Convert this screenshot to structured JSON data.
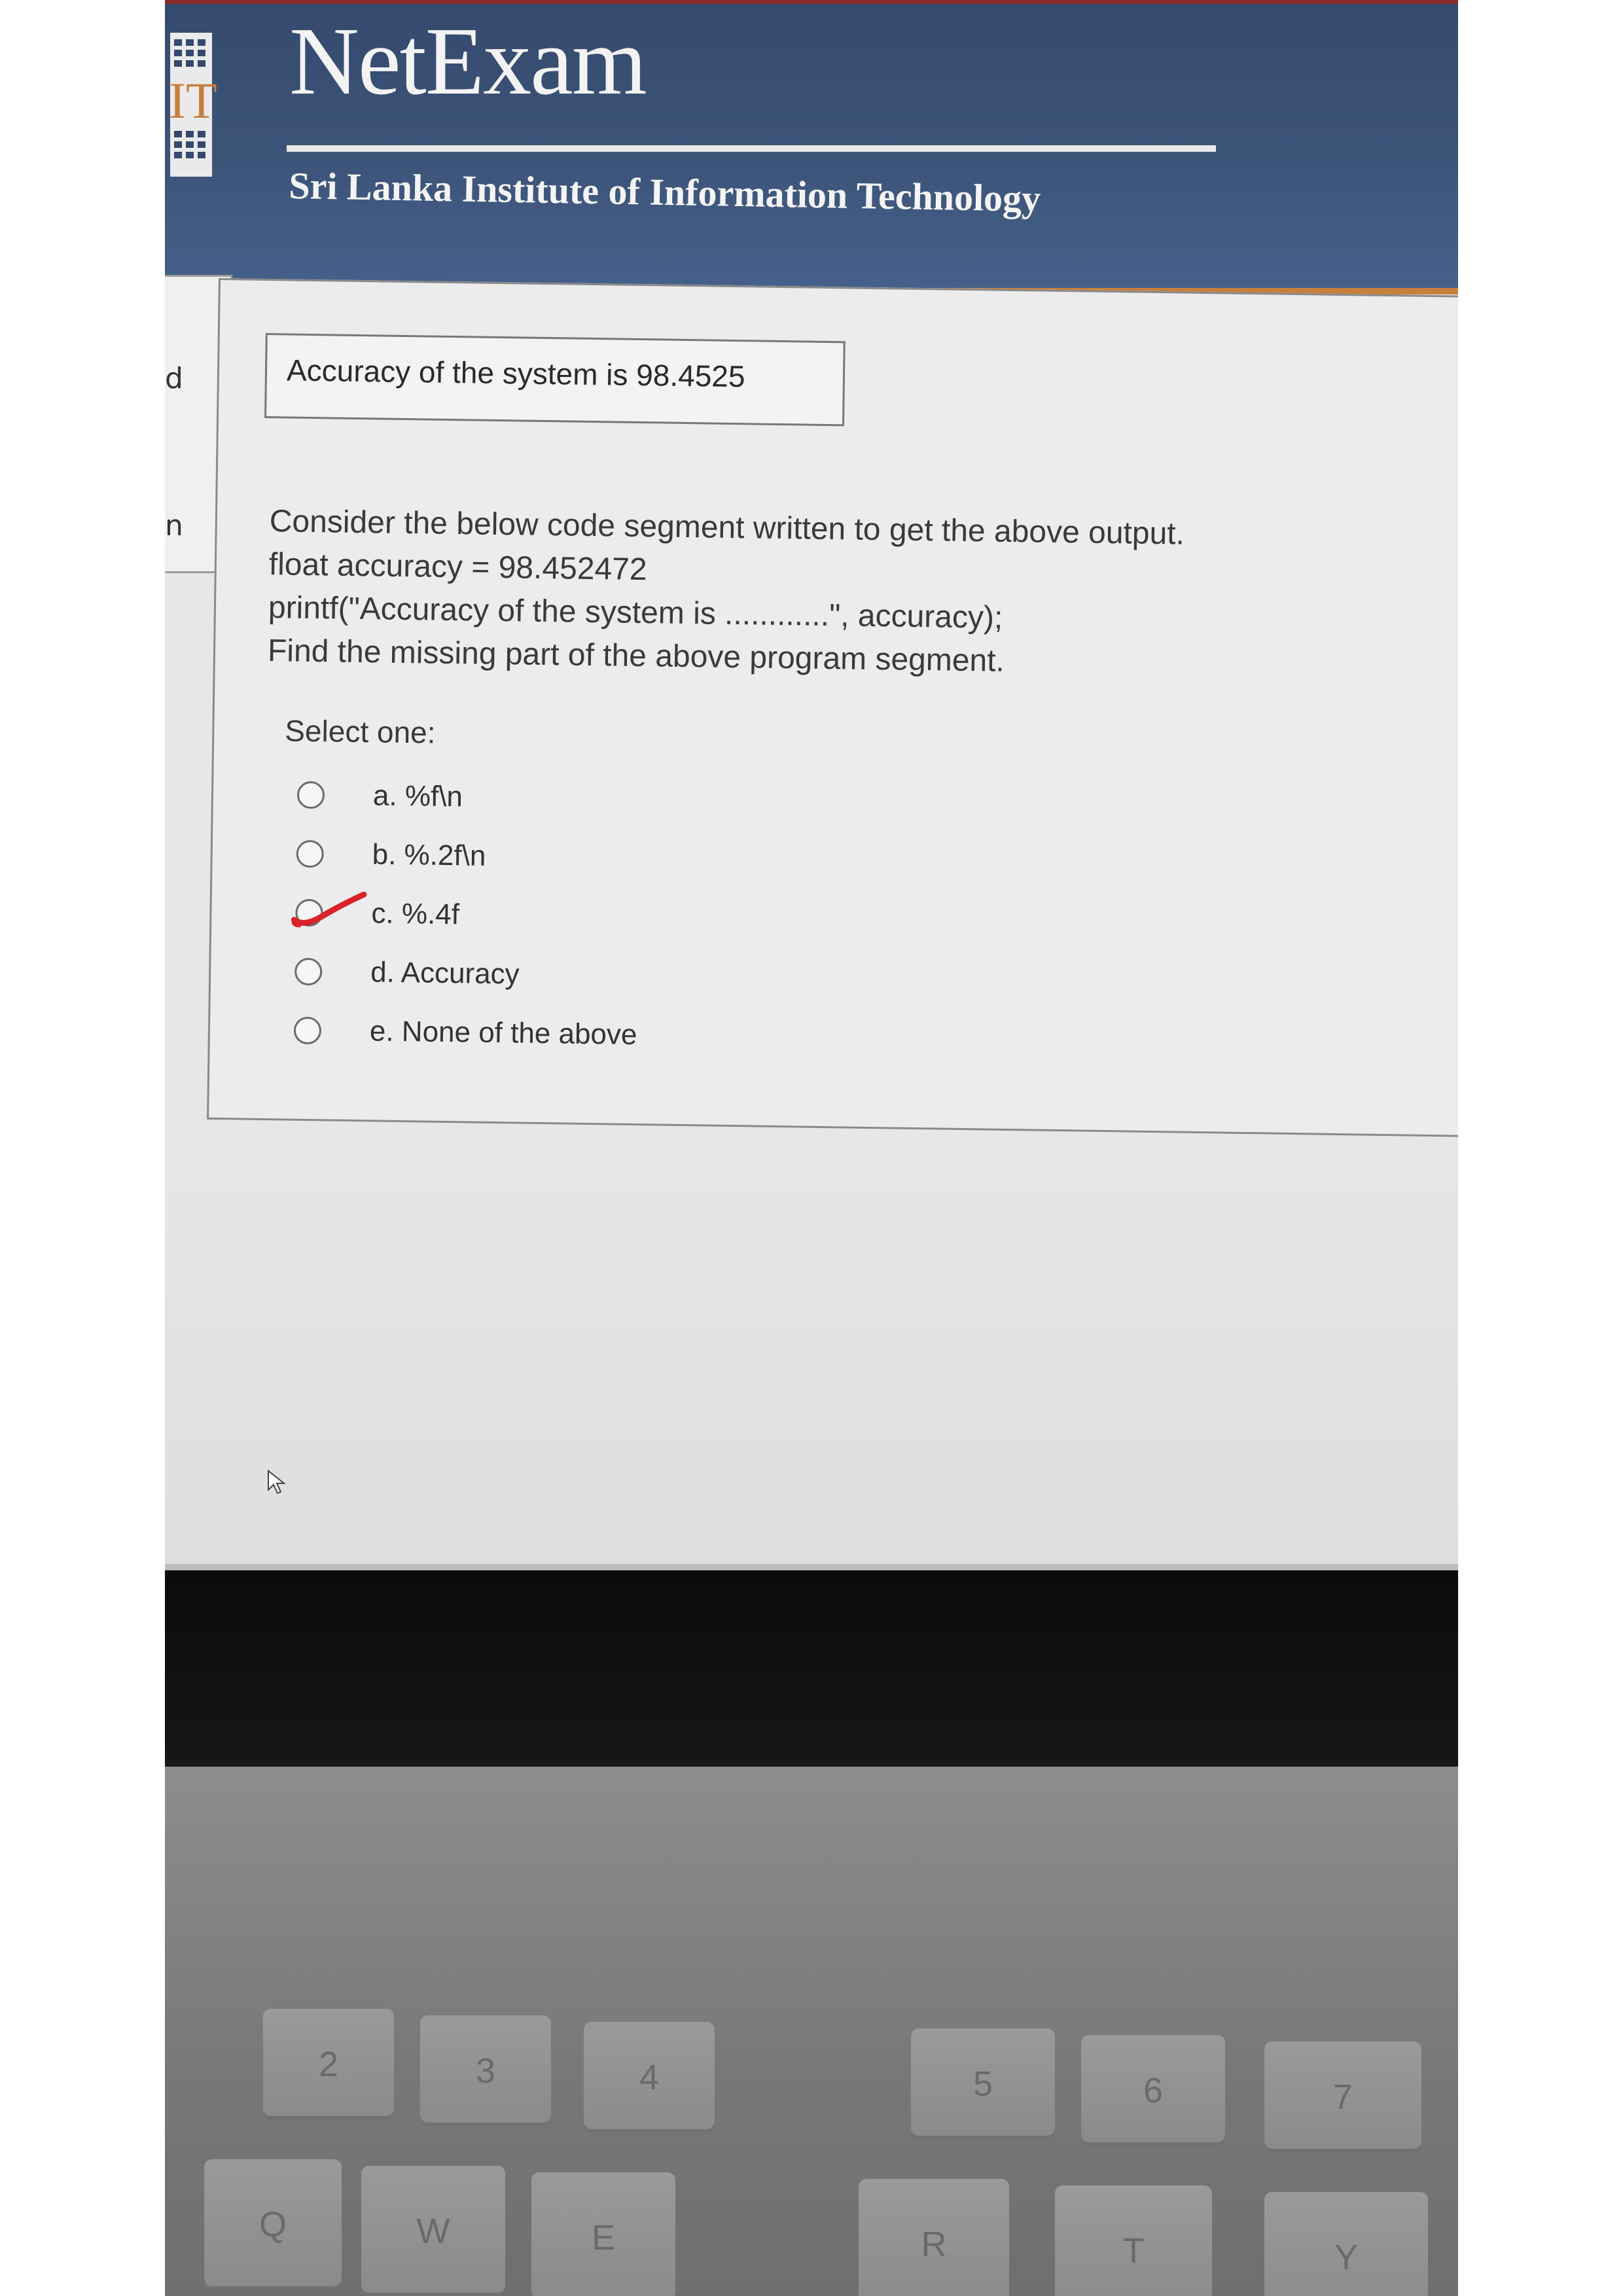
{
  "header": {
    "logo_text": "IT",
    "title": "NetExam",
    "subtitle": "Sri Lanka Institute of Information Technology"
  },
  "left_strip": {
    "fragments": [
      "d",
      "n"
    ]
  },
  "question": {
    "output_text": "Accuracy of the system is 98.4525",
    "lines": [
      "Consider the below code segment written to get the above output.",
      "float accuracy = 98.452472",
      "printf(\"Accuracy of the system is ............\", accuracy);",
      "Find the missing part of the above program segment."
    ],
    "select_label": "Select one:",
    "options": [
      {
        "label": "a. %f\\n",
        "selected": false
      },
      {
        "label": "b. %.2f\\n",
        "selected": false
      },
      {
        "label": "c. %.4f",
        "selected": false,
        "hand_checked": true
      },
      {
        "label": "d. Accuracy",
        "selected": false
      },
      {
        "label": "e. None of the above",
        "selected": false
      }
    ]
  },
  "keyboard": {
    "number_row": [
      "2",
      "3",
      "4",
      "5",
      "6",
      "7"
    ],
    "letter_row": [
      "Q",
      "W",
      "E",
      "R",
      "T",
      "Y"
    ]
  },
  "colors": {
    "header_bg": "#3d5479",
    "accent_border": "#c77f3c",
    "check_mark": "#d8232a"
  }
}
